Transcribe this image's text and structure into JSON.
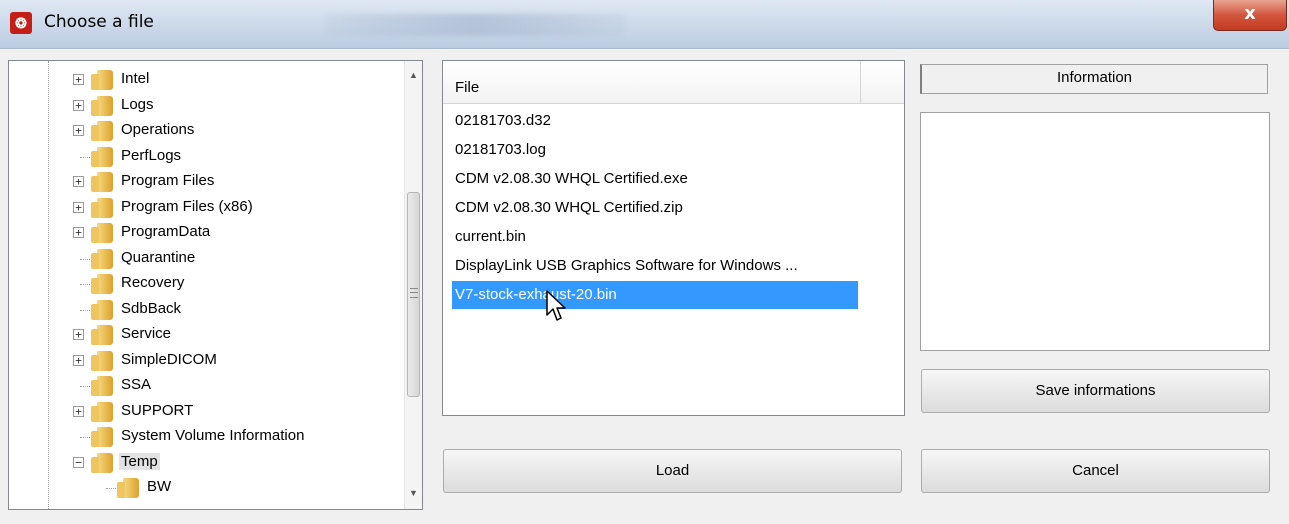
{
  "window": {
    "title": "Choose a file",
    "close_label": "x",
    "app_icon_glyph": "❂"
  },
  "tree": {
    "items": [
      {
        "label": "Intel",
        "expandable": true,
        "expanded": false
      },
      {
        "label": "Logs",
        "expandable": true,
        "expanded": false
      },
      {
        "label": "Operations",
        "expandable": true,
        "expanded": false
      },
      {
        "label": "PerfLogs",
        "expandable": false
      },
      {
        "label": "Program Files",
        "expandable": true,
        "expanded": false
      },
      {
        "label": "Program Files (x86)",
        "expandable": true,
        "expanded": false
      },
      {
        "label": "ProgramData",
        "expandable": true,
        "expanded": false
      },
      {
        "label": "Quarantine",
        "expandable": false
      },
      {
        "label": "Recovery",
        "expandable": false
      },
      {
        "label": "SdbBack",
        "expandable": false
      },
      {
        "label": "Service",
        "expandable": true,
        "expanded": false
      },
      {
        "label": "SimpleDICOM",
        "expandable": true,
        "expanded": false
      },
      {
        "label": "SSA",
        "expandable": false
      },
      {
        "label": "SUPPORT",
        "expandable": true,
        "expanded": false
      },
      {
        "label": "System Volume Information",
        "expandable": false
      },
      {
        "label": "Temp",
        "expandable": true,
        "expanded": true,
        "selected": true
      },
      {
        "label": "BW",
        "expandable": false,
        "child": true
      }
    ],
    "expand_glyph": "+",
    "collapse_glyph": "−"
  },
  "file_list": {
    "column_header": "File",
    "files": [
      "02181703.d32",
      "02181703.log",
      "CDM v2.08.30 WHQL Certified.exe",
      "CDM v2.08.30 WHQL Certified.zip",
      "current.bin",
      "DisplayLink USB Graphics Software for Windows ...",
      "V7-stock-exhaust-20.bin"
    ],
    "selected_index": 6
  },
  "information": {
    "header": "Information",
    "content": ""
  },
  "buttons": {
    "save_informations": "Save informations",
    "load": "Load",
    "cancel": "Cancel"
  },
  "colors": {
    "selection": "#3399ff",
    "close_button": "#c43b22",
    "folder": "#e7b84a"
  }
}
